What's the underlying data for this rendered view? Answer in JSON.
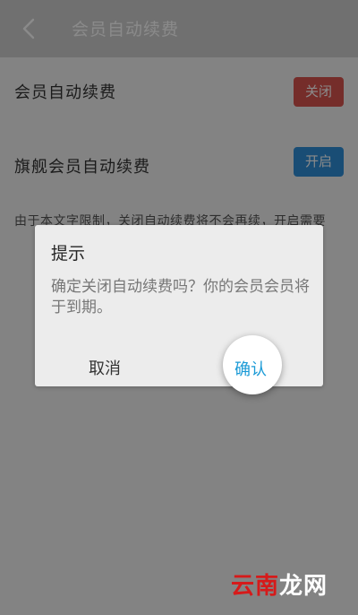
{
  "header": {
    "title": "会员自动续费"
  },
  "settings": {
    "row1": {
      "label": "会员自动续费",
      "button": "关闭"
    },
    "row2": {
      "label": "旗舰会员自动续费",
      "button": "开启"
    },
    "note": "由于本文字限制，关闭自动续费将不会再续，开启需要"
  },
  "dialog": {
    "title": "提示",
    "message": "确定关闭自动续费吗？你的会员会员将于到期。",
    "cancel": "取消",
    "confirm": "确认"
  },
  "watermark": {
    "red_part": "云南",
    "white_part": "龙网"
  },
  "colors": {
    "close_button": "#d9534f",
    "open_button": "#2f8fd8",
    "confirm_text": "#1a9ad6"
  }
}
